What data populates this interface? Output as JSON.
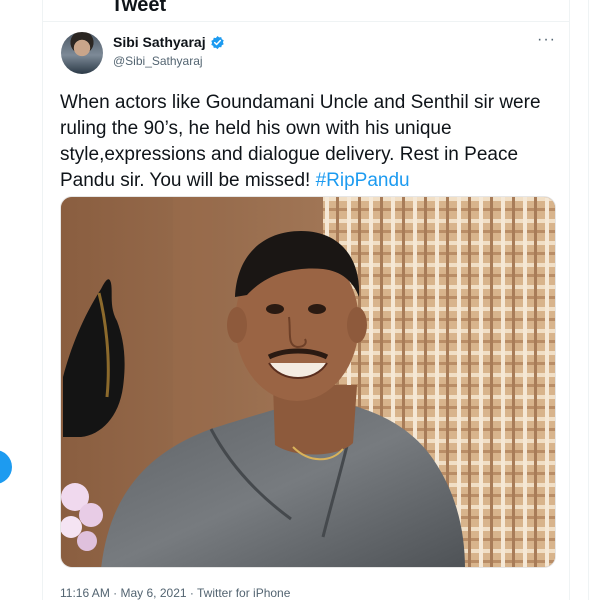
{
  "header": {
    "title": "Tweet"
  },
  "tweet": {
    "author": {
      "display_name": "Sibi Sathyaraj",
      "handle": "@Sibi_Sathyaraj",
      "verified": true
    },
    "text_before_hashtag": "When actors like Goundamani Uncle and Senthil sir were ruling the 90’s, he held his own with his unique style,expressions and dialogue delivery. Rest in Peace Pandu sir. You will be missed! ",
    "hashtag": "#RipPandu",
    "more_menu": "···",
    "photo_subject": "portrait-photo",
    "meta": {
      "time": "11:16 AM",
      "date": "May 6, 2021",
      "source": "Twitter for iPhone",
      "separator": "·"
    }
  },
  "colors": {
    "accent": "#1d9bf0",
    "text_primary": "#0f1419",
    "text_secondary": "#536471",
    "border": "#eff3f4"
  }
}
